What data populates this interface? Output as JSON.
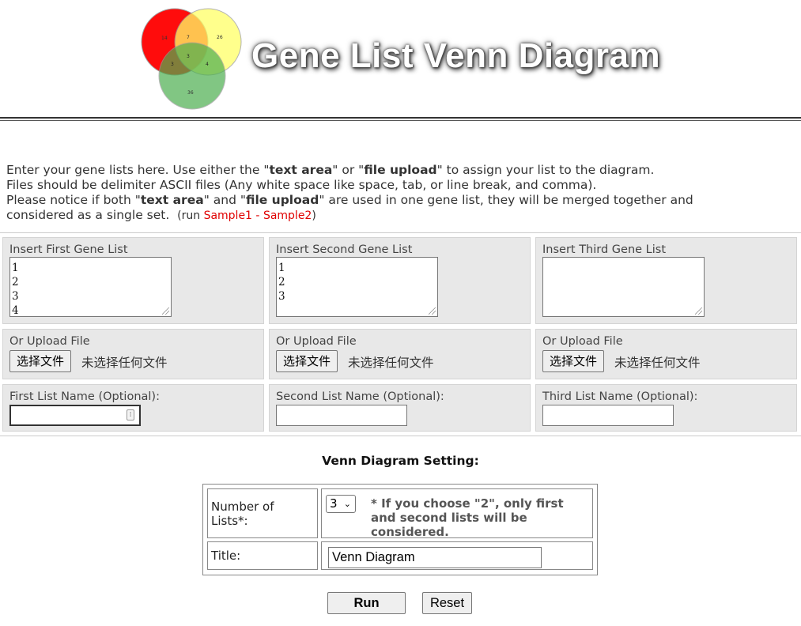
{
  "header": {
    "title": "Gene List Venn Diagram",
    "logo_numbers": {
      "a_only": "14",
      "ab": "7",
      "b_only": "26",
      "abc": "3",
      "ac": "3",
      "bc": "4",
      "c_only": "36"
    },
    "logo_colors": {
      "a": "#ff0000",
      "b": "#ffff66",
      "c": "#4caf50"
    }
  },
  "intro": {
    "l1_a": "Enter your gene lists here. Use either the \"",
    "l1_b": "text area",
    "l1_c": "\" or \"",
    "l1_d": "file upload",
    "l1_e": "\" to assign your list to the diagram.",
    "l2": "Files should be delimiter ASCII files (Any white space like space, tab, or line break, and comma).",
    "l3_a": "Please notice if both \"",
    "l3_b": "text area",
    "l3_c": "\" and \"",
    "l3_d": "file upload",
    "l3_e": "\" are used in one gene list, they will be merged together and",
    "l4": "considered as a single set.",
    "run_open": "(run",
    "sample1": "Sample1",
    "dash": "-",
    "sample2": "Sample2",
    "run_close": ")"
  },
  "lists": [
    {
      "insert_label": "Insert First Gene List",
      "lines": [
        "1",
        "2",
        "3",
        "4"
      ],
      "upload_label": "Or Upload File",
      "file_button": "选择文件",
      "no_file": "未选择任何文件",
      "name_label": "First List Name (Optional):",
      "name_value": ""
    },
    {
      "insert_label": "Insert Second Gene List",
      "lines": [
        "1",
        "2",
        "3"
      ],
      "upload_label": "Or Upload File",
      "file_button": "选择文件",
      "no_file": "未选择任何文件",
      "name_label": "Second List Name (Optional):",
      "name_value": ""
    },
    {
      "insert_label": "Insert Third Gene List",
      "lines": [],
      "upload_label": "Or Upload File",
      "file_button": "选择文件",
      "no_file": "未选择任何文件",
      "name_label": "Third List Name (Optional):",
      "name_value": ""
    }
  ],
  "settings": {
    "heading": "Venn Diagram Setting:",
    "num_lists_label": "Number of Lists*:",
    "num_lists_value": "3",
    "note": "* If you choose \"2\", only first and second lists will be considered.",
    "title_label": "Title:",
    "title_value": "Venn Diagram"
  },
  "buttons": {
    "run": "Run",
    "reset": "Reset"
  },
  "colors": {
    "link_red": "#e00000",
    "panel_bg": "#e8e8e8"
  }
}
